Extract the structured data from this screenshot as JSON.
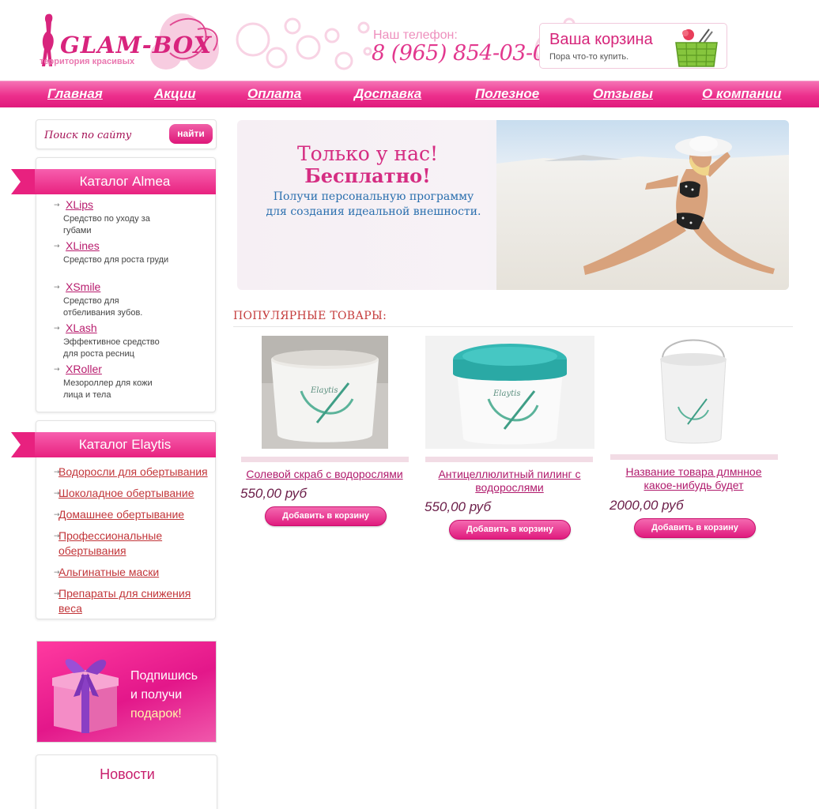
{
  "header": {
    "logo_text": "GLAM-BOX",
    "logo_subtitle": "территория красивых",
    "phone_label": "Наш телефон:",
    "phone_number": "8 (965) 854-03-00",
    "cart_title": "Ваша корзина",
    "cart_subtitle": "Пора что-то купить.",
    "cart_icon": "basket-icon"
  },
  "nav": {
    "items": [
      {
        "label": "Главная"
      },
      {
        "label": "Акции"
      },
      {
        "label": "Оплата"
      },
      {
        "label": "Доставка"
      },
      {
        "label": "Полезное"
      },
      {
        "label": "Отзывы"
      },
      {
        "label": "О компании"
      }
    ]
  },
  "search": {
    "placeholder": "Поиск по сайту",
    "button_label": "найти"
  },
  "catalog_almea": {
    "title": "Каталог Almea",
    "items": [
      {
        "label": "XLips",
        "description": "Средство по уходу за губами"
      },
      {
        "label": "XLines",
        "description": "Средство для роста груди"
      },
      {
        "label": "XSmile",
        "description": "Средство для отбеливания зубов."
      },
      {
        "label": "XLash",
        "description": "Эффективное средство для роста ресниц"
      },
      {
        "label": "XRoller",
        "description": "Мезороллер для кожи лица и тела"
      }
    ]
  },
  "catalog_elaytis": {
    "title": "Каталог Elaytis",
    "items": [
      {
        "label": "Водоросли для обертывания"
      },
      {
        "label": "Шоколадное обертывание"
      },
      {
        "label": "Домашнее обертывание"
      },
      {
        "label": "Профессиональные обертывания"
      },
      {
        "label": "Альгинатные маски"
      },
      {
        "label": "Препараты для снижения веса"
      }
    ]
  },
  "gift_banner": {
    "line1": "Подпишись",
    "line2": "и получи",
    "line3": "подарок!",
    "icon": "gift-box-icon"
  },
  "news": {
    "title": "Новости"
  },
  "hero": {
    "line1": "Только у нас!",
    "line2": "Бесплатно!",
    "line3": "Получи персональную программу",
    "line4": "для создания идеальной внешности."
  },
  "popular": {
    "title": "ПОПУЛЯРНЫЕ ТОВАРЫ:",
    "products": [
      {
        "name": "Солевой скраб с водорослями",
        "price": "550,00 руб",
        "button": "Добавить в корзину",
        "brand": "Elaytis"
      },
      {
        "name": "Антицеллюлитный пилинг с водорослями",
        "price": "550,00 руб",
        "button": "Добавить в корзину",
        "brand": "Elaytis"
      },
      {
        "name": "Название товара длмнное какое-нибудь будет",
        "price": "2000,00 руб",
        "button": "Добавить в корзину",
        "brand": "Elaytis"
      }
    ]
  },
  "colors": {
    "brand_pink": "#e01a7c",
    "nav_gradient_top": "#f572b4",
    "link_red": "#c2363a",
    "hero_blue": "#2a6fae"
  }
}
